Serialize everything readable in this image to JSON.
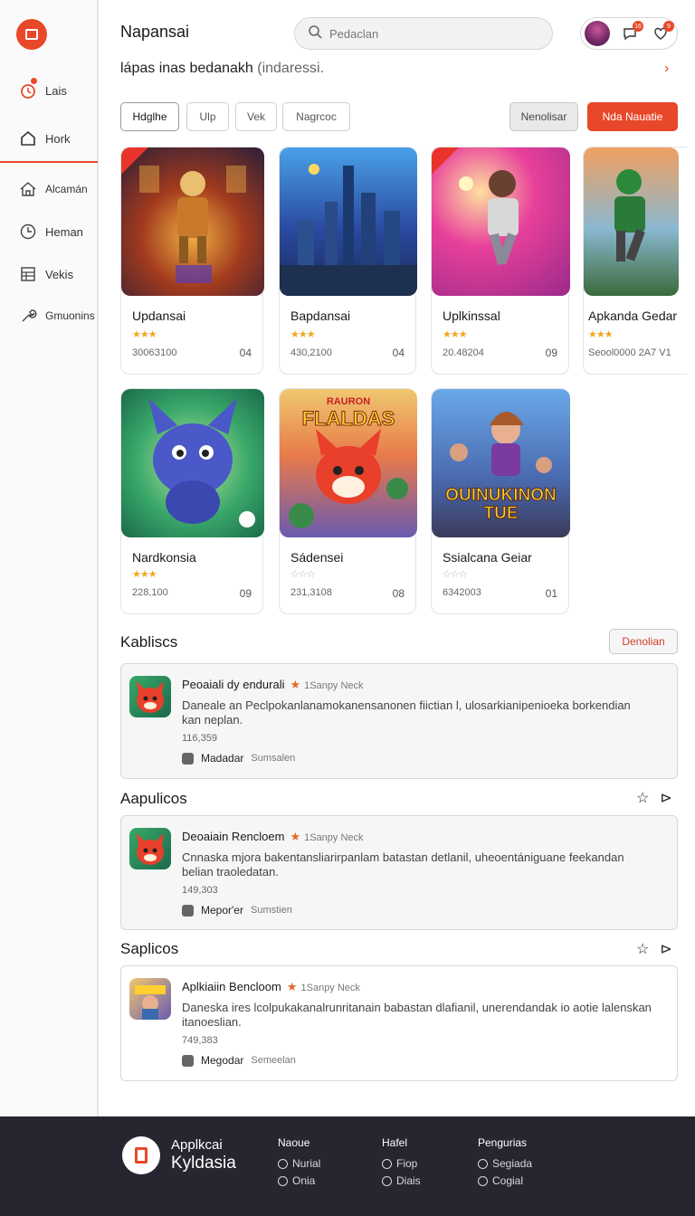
{
  "app": {
    "brand": "Napansai"
  },
  "search": {
    "placeholder": "Pedaclan"
  },
  "header": {
    "notif1_count": "16",
    "notif2_count": "9"
  },
  "subtitle": {
    "main": "lápas inas bedanakh",
    "muted": "(indaressi."
  },
  "sidebar": {
    "items": [
      {
        "label": "Lais",
        "icon": "timer-icon"
      },
      {
        "label": "Hork",
        "icon": "home-icon"
      },
      {
        "label": "Alcamán",
        "icon": "house-icon"
      },
      {
        "label": "Heman",
        "icon": "clock-icon"
      },
      {
        "label": "Vekis",
        "icon": "grid-icon"
      },
      {
        "label": "Gmuonins",
        "icon": "wrench-icon"
      }
    ]
  },
  "filters": {
    "chips": [
      "Hdglhe",
      "Ulp",
      "Vek",
      "Nagrcoc"
    ],
    "gray_button": "Nenolisar",
    "primary_button": "Nda Nauatie"
  },
  "games": [
    {
      "title": "Updansai",
      "stars": "★★★",
      "meta": "3006З100",
      "num": "04"
    },
    {
      "title": "Bapdansai",
      "stars": "★★★",
      "meta": "430,2100",
      "num": "04"
    },
    {
      "title": "Uplkinssal",
      "stars": "★★★",
      "meta": "20.48204",
      "num": "09"
    },
    {
      "title": "Apkanda Gedar",
      "stars": "★★★",
      "meta": "Seool0000 2А7 V1",
      "num": ""
    },
    {
      "title": "Nardkonsia",
      "stars": "★★★",
      "meta": "228,100",
      "num": "09"
    },
    {
      "title": "Sádensei",
      "stars": "☆☆☆",
      "meta": "231,3108",
      "num": "08"
    },
    {
      "title": "Ssialcana Geiar",
      "stars": "☆☆☆",
      "meta": "6342003",
      "num": "01"
    }
  ],
  "game_banners": {
    "g6": "FLALDAS",
    "g6_top": "RAURON",
    "g7_line1": "OUINUKINON",
    "g7_line2": "TUE"
  },
  "sections": [
    {
      "title": "Kabliscs",
      "button": "Denolian"
    },
    {
      "title": "Aapulicos"
    },
    {
      "title": "Saplicos"
    }
  ],
  "apps": [
    {
      "name": "Peoaiali dy endurali",
      "tag": "1Sanpy Neck",
      "desc": "Daneale an Peclpokanlanamokanensanonen fiictian l, ulosarkianipenioeka borkendian kan neplan.",
      "count": "116,359",
      "foot": "Madadar",
      "foot_sub": "Sumsalen"
    },
    {
      "name": "Deoaiain Rencloem",
      "tag": "1Sanpy Neck",
      "desc": "Cnnaska mjora bakentansliarirpanlam batastan detlanil, uheoentániguane feekandan belian traoledatan.",
      "count": "149,303",
      "foot": "Mepor'er",
      "foot_sub": "Sumstien"
    },
    {
      "name": "Aplkiaiin Bencloom",
      "tag": "1Sanpy Neck",
      "desc": "Daneska ires lcolpukakanalrunritanain babastan dlafianil, unerendandak io aotie lalenskan itanoeslian.",
      "count": "749,383",
      "foot": "Megodar",
      "foot_sub": "Semeelan"
    }
  ],
  "footer": {
    "brand_line1": "Applkcai",
    "brand_line2": "Kyldasia",
    "cols": [
      {
        "heading": "Naoue",
        "links": [
          "Nurial",
          "Onia"
        ]
      },
      {
        "heading": "Hafel",
        "links": [
          "Fiop",
          "Diais"
        ]
      },
      {
        "heading": "Pengurias",
        "links": [
          "Segiada",
          "Cogial"
        ]
      }
    ]
  },
  "colors": {
    "accent": "#e8482a",
    "footer_bg": "#262530"
  }
}
